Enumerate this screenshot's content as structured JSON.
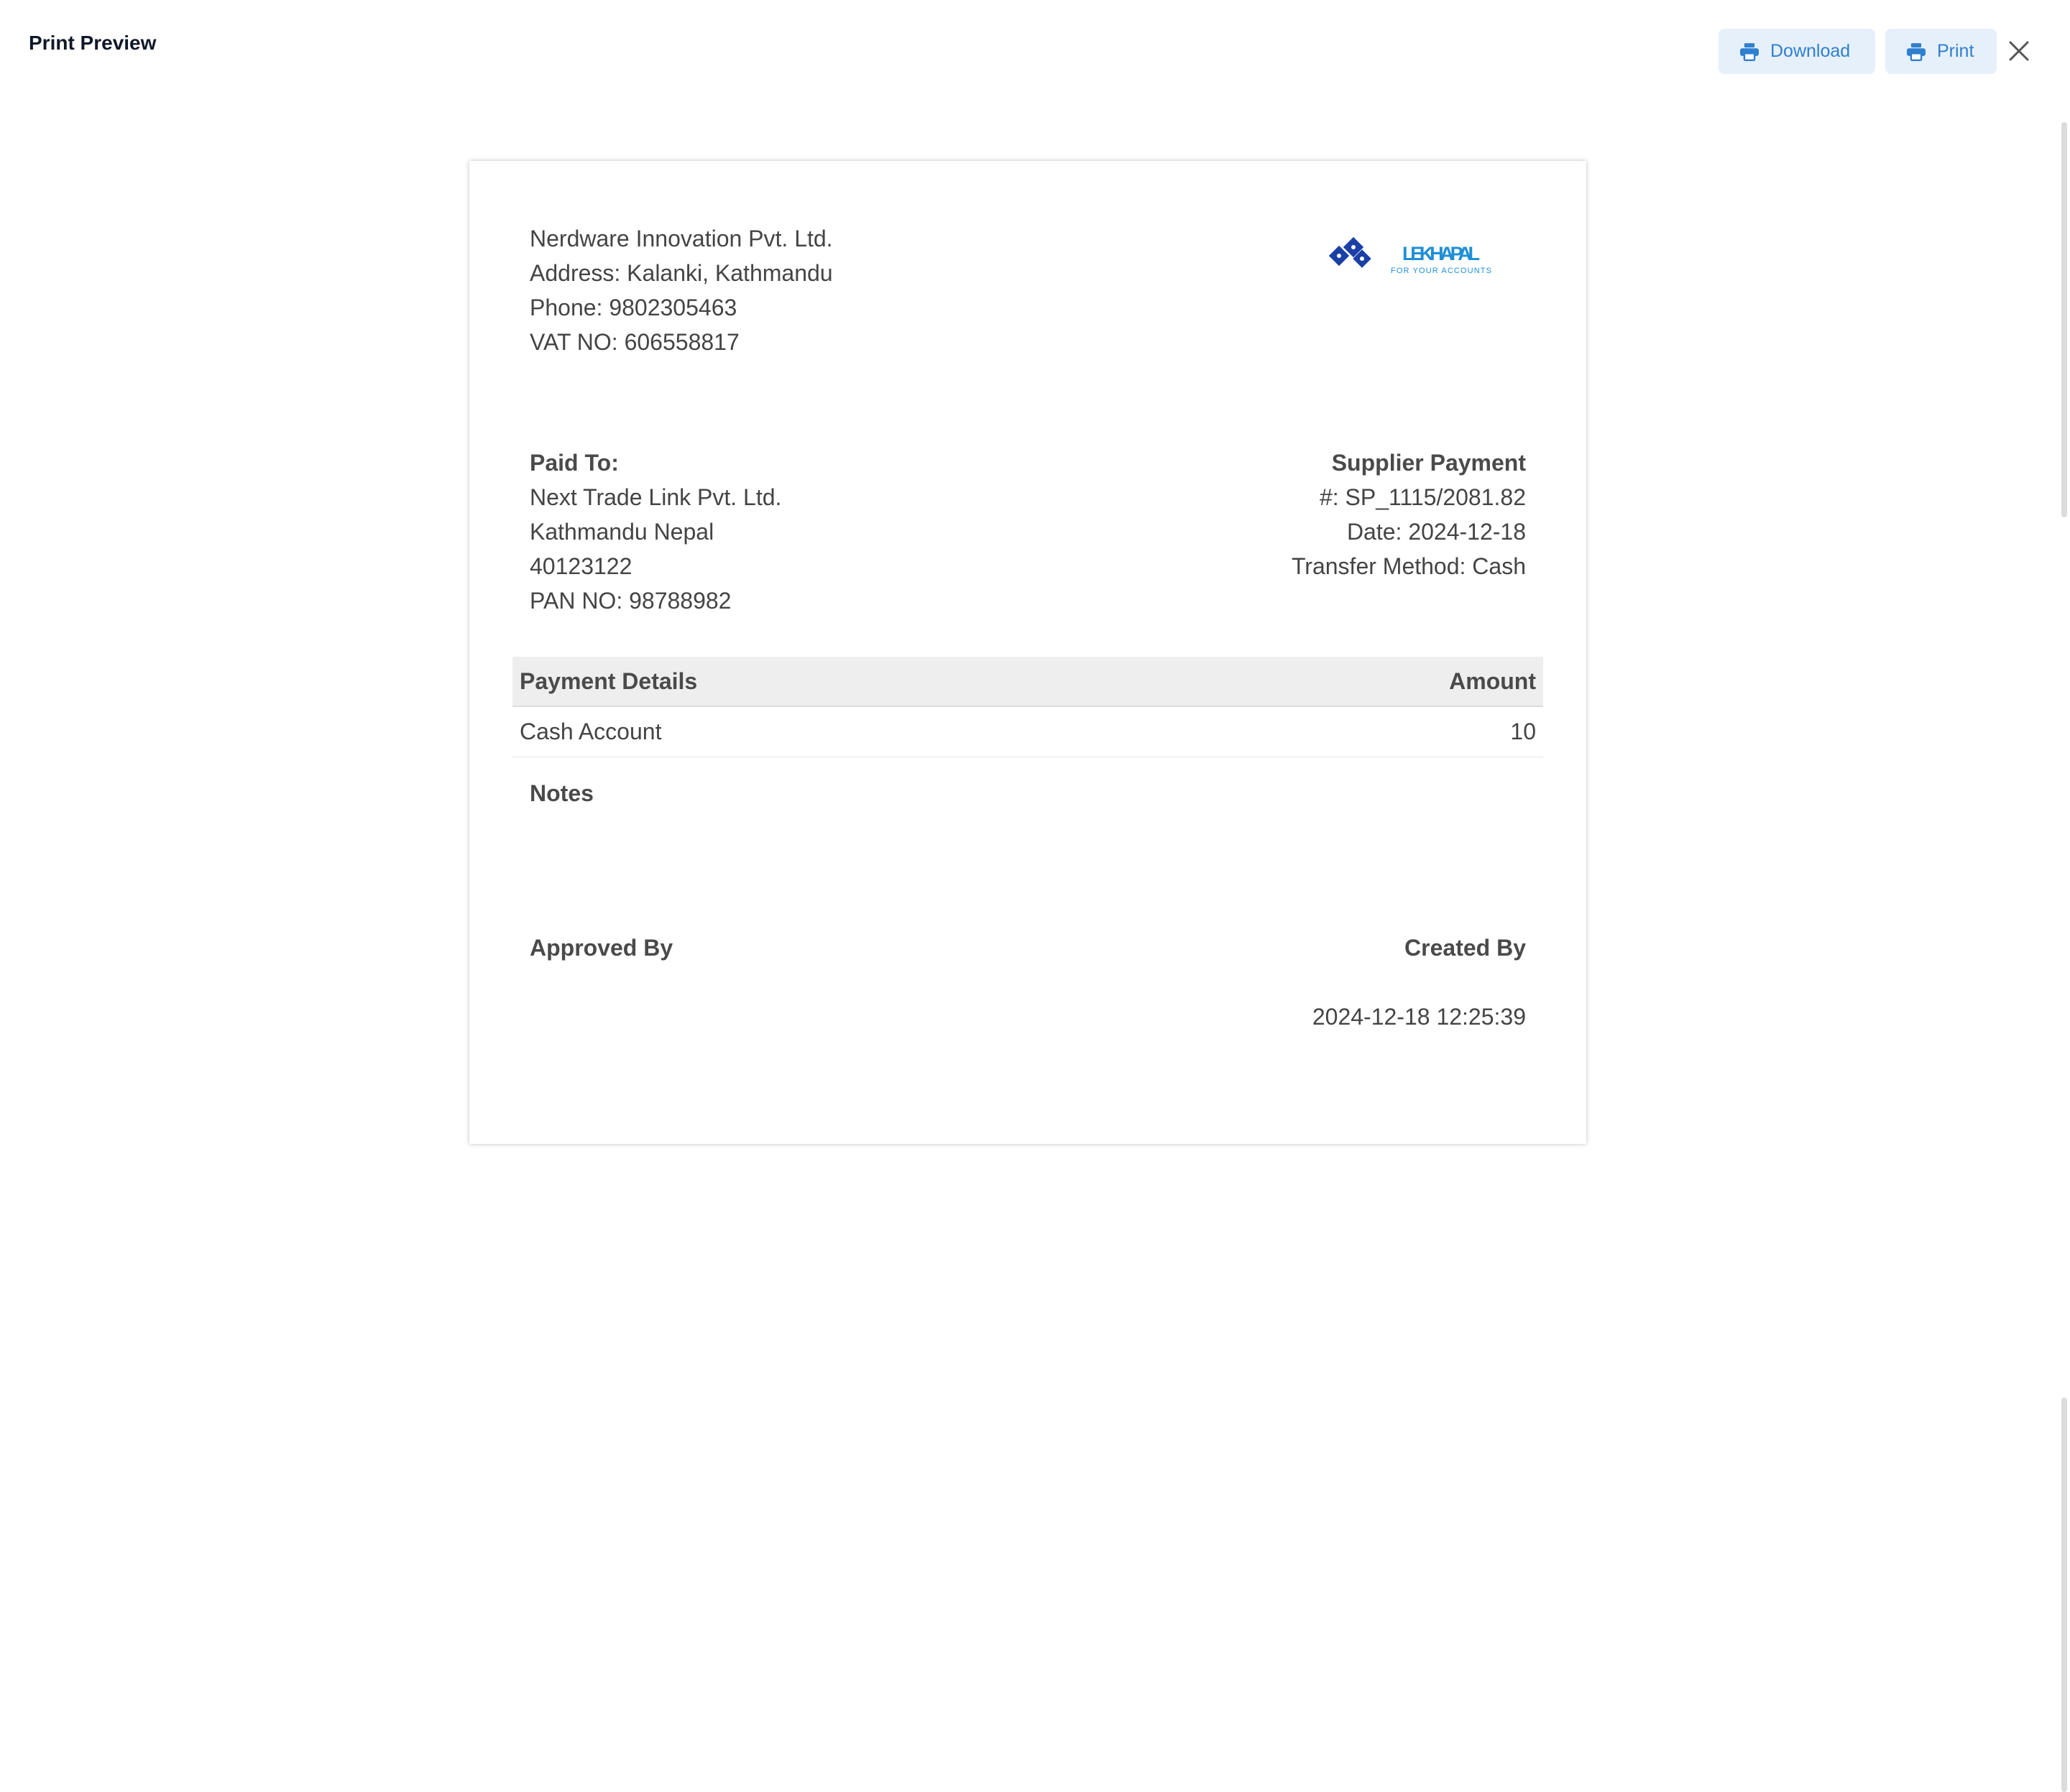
{
  "header": {
    "title": "Print Preview",
    "download_label": "Download",
    "print_label": "Print"
  },
  "company": {
    "name": "Nerdware Innovation Pvt. Ltd.",
    "address": "Address: Kalanki, Kathmandu",
    "phone": "Phone: 9802305463",
    "vat": "VAT NO: 606558817"
  },
  "logo": {
    "brand": "LEKHAPAL",
    "tagline": "FOR YOUR ACCOUNTS",
    "brand_color": "#1f8fd6",
    "mark_color": "#1a3fa6"
  },
  "paid_to": {
    "label": "Paid To:",
    "name": "Next Trade Link Pvt. Ltd.",
    "address": "Kathmandu Nepal",
    "number": "40123122",
    "pan": "PAN NO: 98788982"
  },
  "voucher": {
    "type": "Supplier Payment",
    "number": "#: SP_1115/2081.82",
    "date": "Date: 2024-12-18",
    "method": "Transfer Method: Cash"
  },
  "table": {
    "headers": [
      "Payment Details",
      "Amount"
    ],
    "rows": [
      {
        "detail": "Cash Account",
        "amount": "10"
      }
    ]
  },
  "notes": {
    "label": "Notes"
  },
  "signatures": {
    "approved_by": "Approved By",
    "created_by": "Created By",
    "created_at": "2024-12-18 12:25:39"
  }
}
